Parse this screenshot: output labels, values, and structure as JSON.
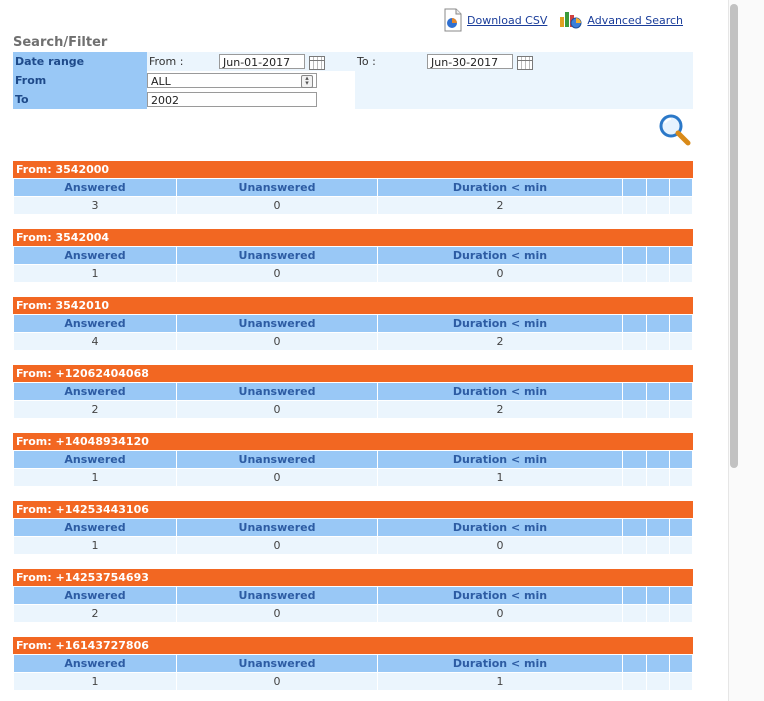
{
  "links": {
    "download_csv": "Download CSV",
    "advanced_search": "Advanced Search"
  },
  "filter": {
    "title": "Search/Filter",
    "date_range_label": "Date range",
    "from_prefix": "From :",
    "from_date": "Jun-01-2017",
    "to_prefix": "To :",
    "to_date": "Jun-30-2017",
    "from_label": "From",
    "from_value": "ALL",
    "to_label": "To",
    "to_value": "2002"
  },
  "columns": [
    "Answered",
    "Unanswered",
    "Duration < min"
  ],
  "groups": [
    {
      "label": "From: 3542000",
      "answered": "3",
      "unanswered": "0",
      "duration": "2"
    },
    {
      "label": "From: 3542004",
      "answered": "1",
      "unanswered": "0",
      "duration": "0"
    },
    {
      "label": "From: 3542010",
      "answered": "4",
      "unanswered": "0",
      "duration": "2"
    },
    {
      "label": "From: +12062404068",
      "answered": "2",
      "unanswered": "0",
      "duration": "2"
    },
    {
      "label": "From: +14048934120",
      "answered": "1",
      "unanswered": "0",
      "duration": "1"
    },
    {
      "label": "From: +14253443106",
      "answered": "1",
      "unanswered": "0",
      "duration": "0"
    },
    {
      "label": "From: +14253754693",
      "answered": "2",
      "unanswered": "0",
      "duration": "0"
    },
    {
      "label": "From: +16143727806",
      "answered": "1",
      "unanswered": "0",
      "duration": "1"
    }
  ],
  "colors": {
    "header_orange": "#f26722",
    "label_blue": "#99c8f6",
    "row_light": "#ebf5fd",
    "link": "#1a3d9a"
  }
}
